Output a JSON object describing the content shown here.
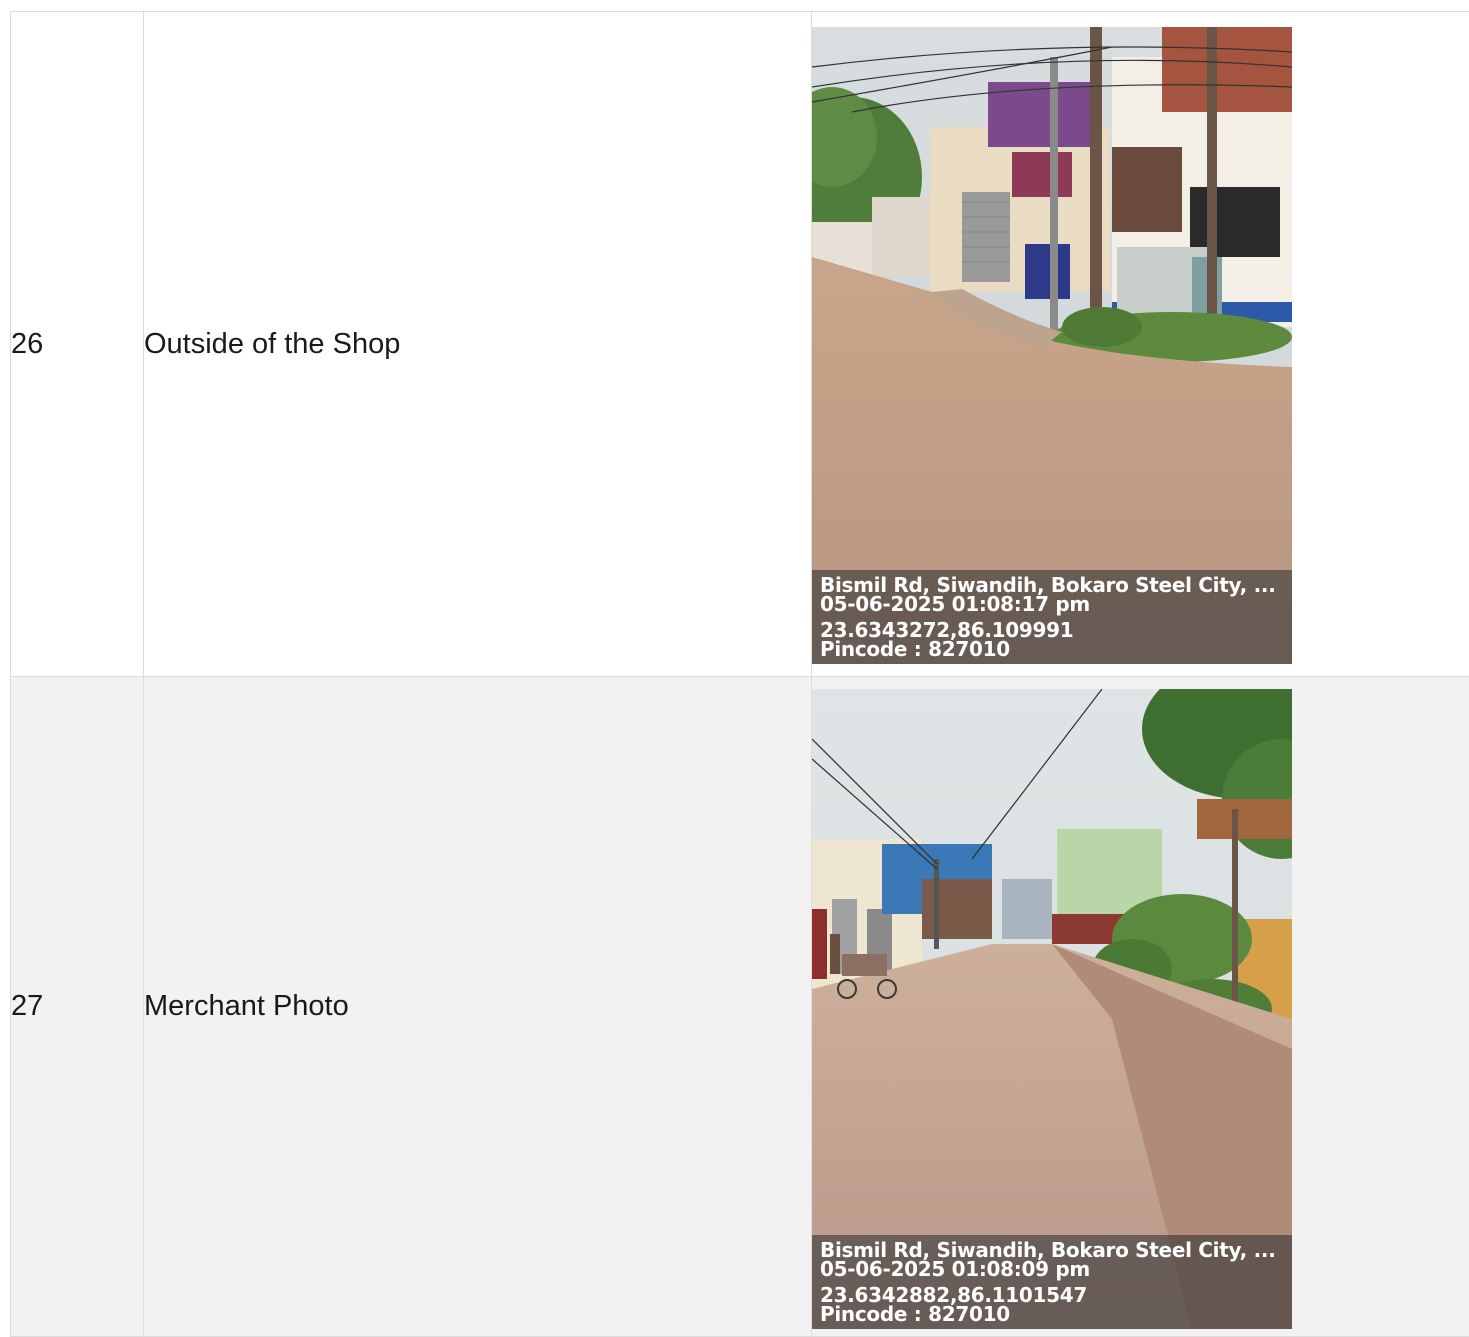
{
  "rows": [
    {
      "number": "26",
      "description": "Outside of the Shop",
      "photo": {
        "address": "Bismil Rd, Siwandih, Bokaro Steel City, ...",
        "datetime": "05-06-2025 01:08:17 pm",
        "coordinates": "23.6343272,86.109991",
        "pincode": "Pincode : 827010"
      }
    },
    {
      "number": "27",
      "description": "Merchant Photo",
      "photo": {
        "address": "Bismil Rd, Siwandih, Bokaro Steel City, ...",
        "datetime": "05-06-2025 01:08:09 pm",
        "coordinates": "23.6342882,86.1101547",
        "pincode": "Pincode : 827010"
      }
    }
  ],
  "colors": {
    "border": "#dcdcdc",
    "row_alt_background": "#f2f2f2",
    "stamp_background": "#373737"
  }
}
